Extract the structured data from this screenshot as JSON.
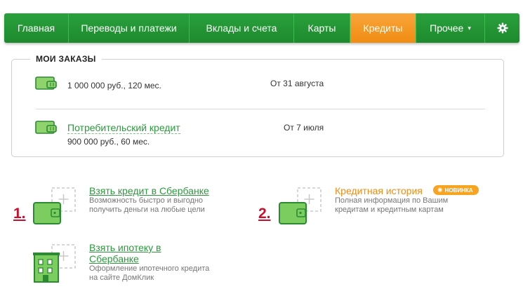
{
  "nav": {
    "items": [
      {
        "label": "Главная"
      },
      {
        "label": "Переводы и платежи"
      },
      {
        "label": "Вклады и счета"
      },
      {
        "label": "Карты"
      },
      {
        "label": "Кредиты"
      },
      {
        "label": "Прочее"
      }
    ],
    "active_item": "Кредиты",
    "more_caret": "▾",
    "settings_icon": "gear-icon",
    "colors": {
      "green": "#21973a",
      "active": "#f5961e"
    }
  },
  "orders": {
    "title": "МОИ ЗАКАЗЫ",
    "items": [
      {
        "amount": "1 000 000 руб., 120 мес.",
        "date": "От 31 августа"
      },
      {
        "link": "Потребительский кредит",
        "amount": "900 000 руб., 60 мес.",
        "date": "От 7 июля"
      }
    ]
  },
  "products": {
    "credit": {
      "number": "1.",
      "title": "Взять кредит в Сбербанке",
      "desc_line1": "Возможность быстро и выгодно",
      "desc_line2": "получить деньги на любые цели"
    },
    "history": {
      "number": "2.",
      "title": "Кредитная история",
      "badge": "НОВИНКА",
      "desc_line1": "Полная информация по Вашим",
      "desc_line2": "кредитам и кредитным картам"
    },
    "mortgage": {
      "title_line1": "Взять ипотеку в",
      "title_line2": "Сбербанке",
      "desc_line1": "Оформление ипотечного кредита",
      "desc_line2": "на сайте ДомКлик"
    }
  },
  "colors": {
    "link_green": "#2a9a3b",
    "orange": "#f08c12",
    "red_number": "#c8102e"
  }
}
